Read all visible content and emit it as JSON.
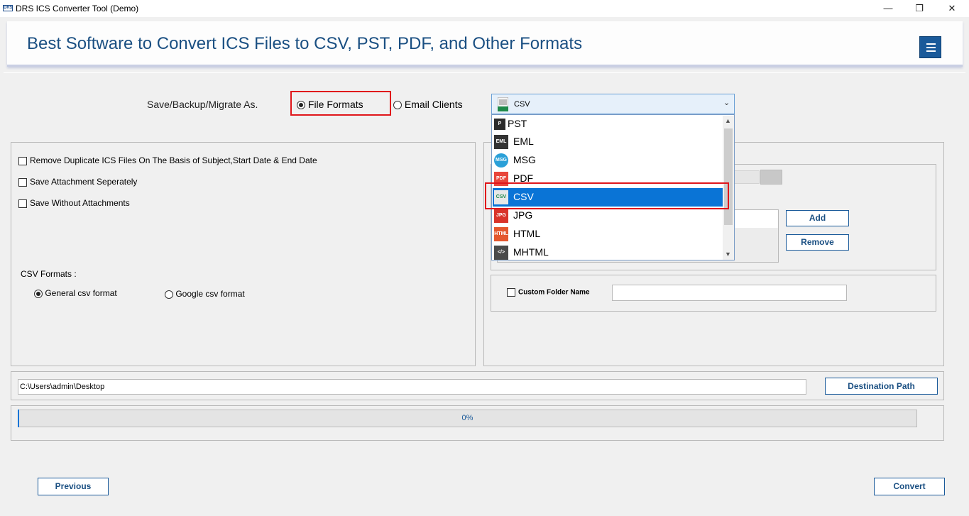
{
  "window": {
    "title": "DRS ICS Converter Tool (Demo)",
    "icon_text": "DRS",
    "minimize": "—",
    "restore": "❐",
    "close": "✕"
  },
  "header": {
    "title": "Best Software to Convert ICS Files to CSV, PST, PDF, and Other Formats"
  },
  "save_as": {
    "label": "Save/Backup/Migrate As.",
    "options": [
      {
        "label": "File Formats",
        "selected": true
      },
      {
        "label": "Email Clients",
        "selected": false
      }
    ]
  },
  "format_select": {
    "value": "CSV",
    "items": [
      {
        "label": "PST",
        "icon": "pst-icon",
        "color": "#2b2b2b"
      },
      {
        "label": "EML",
        "icon": "eml-icon",
        "color": "#333333"
      },
      {
        "label": "MSG",
        "icon": "msg-icon",
        "color": "#2aa0d8"
      },
      {
        "label": "PDF",
        "icon": "pdf-icon",
        "color": "#e8463b"
      },
      {
        "label": "CSV",
        "icon": "csv-icon",
        "color": "#1e8a4a",
        "selected": true
      },
      {
        "label": "JPG",
        "icon": "jpg-icon",
        "color": "#d9342b"
      },
      {
        "label": "HTML",
        "icon": "html-icon",
        "color": "#e4572e"
      },
      {
        "label": "MHTML",
        "icon": "mhtml-icon",
        "color": "#4a4a4a"
      }
    ]
  },
  "options": [
    {
      "label": "Remove Duplicate ICS Files On The Basis of Subject,Start Date & End Date",
      "checked": false
    },
    {
      "label": "Save Attachment Seperately",
      "checked": false
    },
    {
      "label": "Save Without Attachments",
      "checked": false
    }
  ],
  "csv_formats": {
    "label": "CSV Formats :",
    "options": [
      {
        "label": "General csv format",
        "selected": true
      },
      {
        "label": "Google csv format",
        "selected": false
      }
    ]
  },
  "right": {
    "add_label": "Add",
    "remove_label": "Remove",
    "custom_folder_label": "Custom Folder Name",
    "custom_folder_value": ""
  },
  "destination": {
    "path": "C:\\Users\\admin\\Desktop",
    "button_label": "Destination Path"
  },
  "progress": {
    "value": 0,
    "text": "0%"
  },
  "footer": {
    "previous_label": "Previous",
    "convert_label": "Convert"
  },
  "colors": {
    "accent": "#1a5a9a",
    "selection": "#0a74d6",
    "highlight": "#e0161b"
  }
}
